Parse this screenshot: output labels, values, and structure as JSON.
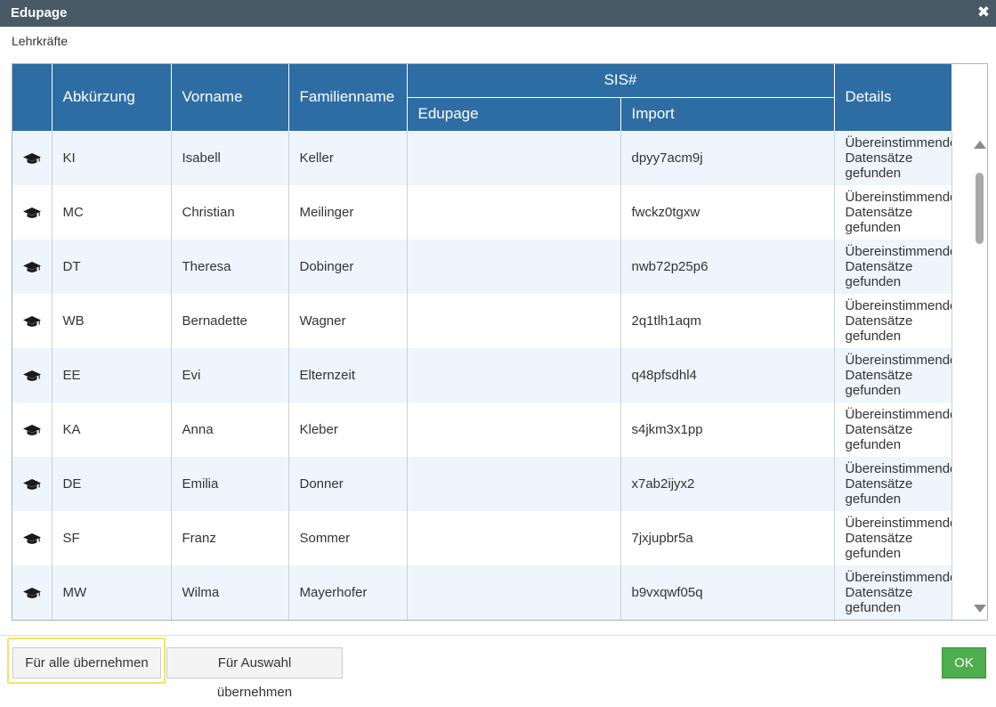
{
  "window": {
    "title": "Edupage"
  },
  "section": {
    "label": "Lehrkräfte"
  },
  "columns": {
    "abkuerzung": "Abkürzung",
    "vorname": "Vorname",
    "familienname": "Familienname",
    "sis": "SIS#",
    "edupage": "Edupage",
    "import": "Import",
    "details": "Details"
  },
  "rows": [
    {
      "icon": "graduation-cap-icon",
      "abk": "KI",
      "vorname": "Isabell",
      "familienname": "Keller",
      "edupage": "",
      "import": "dpyy7acm9j",
      "details_1": "Übereinstimmende",
      "details_2": "Datensätze",
      "details_3": "gefunden"
    },
    {
      "icon": "graduation-cap-icon",
      "abk": "MC",
      "vorname": "Christian",
      "familienname": "Meilinger",
      "edupage": "",
      "import": "fwckz0tgxw",
      "details_1": "Übereinstimmende",
      "details_2": "Datensätze",
      "details_3": "gefunden"
    },
    {
      "icon": "graduation-cap-icon",
      "abk": "DT",
      "vorname": "Theresa",
      "familienname": "Dobinger",
      "edupage": "",
      "import": "nwb72p25p6",
      "details_1": "Übereinstimmende",
      "details_2": "Datensätze",
      "details_3": "gefunden"
    },
    {
      "icon": "graduation-cap-icon",
      "abk": "WB",
      "vorname": "Bernadette",
      "familienname": "Wagner",
      "edupage": "",
      "import": "2q1tlh1aqm",
      "details_1": "Übereinstimmende",
      "details_2": "Datensätze",
      "details_3": "gefunden"
    },
    {
      "icon": "graduation-cap-icon",
      "abk": "EE",
      "vorname": "Evi",
      "familienname": "Elternzeit",
      "edupage": "",
      "import": "q48pfsdhl4",
      "details_1": "Übereinstimmende",
      "details_2": "Datensätze",
      "details_3": "gefunden"
    },
    {
      "icon": "graduation-cap-icon",
      "abk": "KA",
      "vorname": "Anna",
      "familienname": "Kleber",
      "edupage": "",
      "import": "s4jkm3x1pp",
      "details_1": "Übereinstimmende",
      "details_2": "Datensätze",
      "details_3": "gefunden"
    },
    {
      "icon": "graduation-cap-icon",
      "abk": "DE",
      "vorname": "Emilia",
      "familienname": "Donner",
      "edupage": "",
      "import": "x7ab2ijyx2",
      "details_1": "Übereinstimmende",
      "details_2": "Datensätze",
      "details_3": "gefunden"
    },
    {
      "icon": "graduation-cap-icon",
      "abk": "SF",
      "vorname": "Franz",
      "familienname": "Sommer",
      "edupage": "",
      "import": "7jxjupbr5a",
      "details_1": "Übereinstimmende",
      "details_2": "Datensätze",
      "details_3": "gefunden"
    },
    {
      "icon": "graduation-cap-icon",
      "abk": "MW",
      "vorname": "Wilma",
      "familienname": "Mayerhofer",
      "edupage": "",
      "import": "b9vxqwf05q",
      "details_1": "Übereinstimmende",
      "details_2": "Datensätze",
      "details_3": "gefunden"
    }
  ],
  "footer": {
    "apply_all_label": "Für alle übernehmen",
    "apply_selection_label": "Für Auswahl übernehmen",
    "ok_label": "OK"
  },
  "colors": {
    "titlebar": "#475a66",
    "header": "#2e6da4",
    "row_alt": "#eef5fc",
    "ok_button": "#4cae4c",
    "highlight": "#f2e36a"
  }
}
